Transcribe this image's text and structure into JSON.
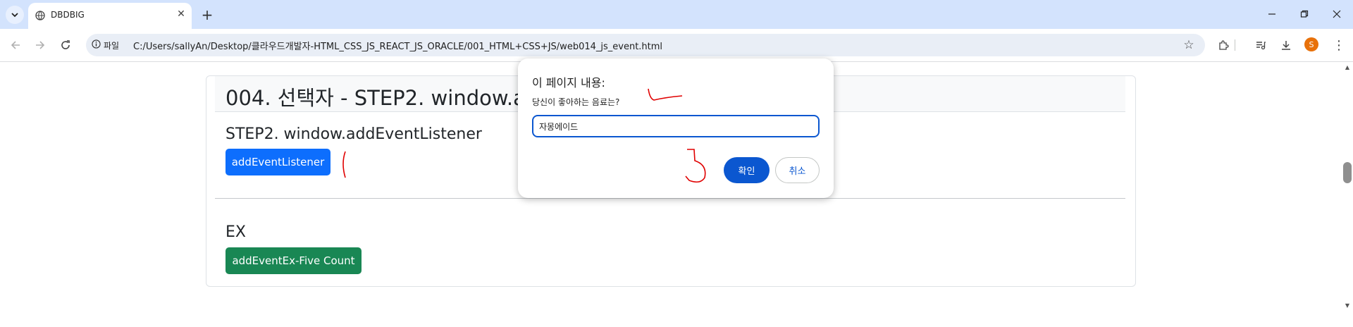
{
  "browser": {
    "tab_title": "DBDBIG",
    "site_chip_label": "파일",
    "url": "C:/Users/sallyAn/Desktop/클라우드개발자-HTML_CSS_JS_REACT_JS_ORACLE/001_HTML+CSS+JS/web014_js_event.html",
    "profile_initial": "S",
    "icons": [
      "tab-search-icon",
      "globe-icon",
      "close-icon",
      "plus-icon",
      "minimize-icon",
      "restore-icon",
      "close-window-icon",
      "back-icon",
      "forward-icon",
      "reload-icon",
      "info-icon",
      "star-icon",
      "extensions-icon",
      "media-icon",
      "download-icon",
      "kebab-menu-icon"
    ]
  },
  "page": {
    "header_title": "004. 선택자 - STEP2. window.addEventListener",
    "step2_heading": "STEP2. window.addEventListener",
    "step2_button": "addEventListener",
    "ex_heading": "EX",
    "ex_button": "addEventEx-Five Count"
  },
  "dialog": {
    "title": "이 페이지 내용:",
    "message": "당신이 좋아하는 음료는?",
    "input_value": "자몽에이드",
    "ok_label": "확인",
    "cancel_label": "취소"
  },
  "colors": {
    "primary": "#0d6efd",
    "success": "#198754",
    "dialog_accent": "#0b57d0",
    "annotation": "#e00000"
  }
}
